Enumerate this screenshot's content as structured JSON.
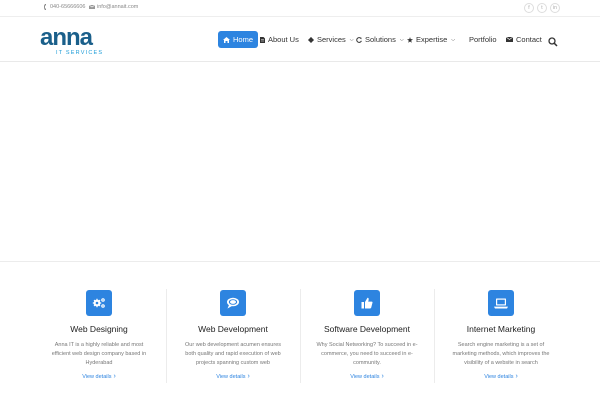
{
  "topbar": {
    "phone": "040-65666606",
    "email": "info@annait.com",
    "social": [
      {
        "icon": "facebook-icon",
        "glyph": "f"
      },
      {
        "icon": "twitter-icon",
        "glyph": "t"
      },
      {
        "icon": "linkedin-icon",
        "glyph": "in"
      }
    ]
  },
  "brand": {
    "logo_text": "anna",
    "tagline": "IT SERVICES",
    "logo_color": "#1a5f8a",
    "tagline_color": "#1a9bd7"
  },
  "nav": {
    "items": [
      {
        "label": "Home",
        "icon": "home-icon",
        "active": true
      },
      {
        "label": "About Us",
        "icon": "document-icon"
      },
      {
        "label": "Services",
        "icon": "gear-icon",
        "dropdown": true
      },
      {
        "label": "Solutions",
        "icon": "refresh-icon",
        "dropdown": true
      },
      {
        "label": "Expertise",
        "icon": "star-icon",
        "dropdown": true
      },
      {
        "label": "Portfolio"
      },
      {
        "label": "Contact",
        "icon": "envelope-icon"
      }
    ],
    "search_icon": "search-icon"
  },
  "features": [
    {
      "icon": "gears-icon",
      "title": "Web Designing",
      "desc_lines": [
        "Anna IT is a highly reliable and most",
        "efficient web design company based in",
        "Hyderabad"
      ],
      "link": "View details"
    },
    {
      "icon": "chat-icon",
      "title": "Web Development",
      "desc_lines": [
        "Our web development acumen ensures",
        "both quality and rapid execution of web",
        "projects spanning custom web"
      ],
      "link": "View details"
    },
    {
      "icon": "thumbs-up-icon",
      "title": "Software Development",
      "desc_lines": [
        "Why Social Networking? To succeed in e-",
        "commerce, you need to succeed in e-",
        "community."
      ],
      "link": "View details"
    },
    {
      "icon": "laptop-icon",
      "title": "Internet Marketing",
      "desc_lines": [
        "Search engine marketing is a set of",
        "marketing methods, which improves the",
        "visibility of a website in search"
      ],
      "link": "View details"
    }
  ],
  "colors": {
    "accent": "#2d84e0",
    "text": "#222222",
    "muted": "#777777"
  }
}
